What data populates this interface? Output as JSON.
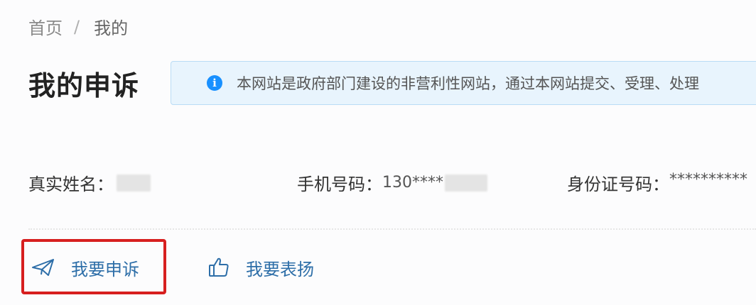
{
  "breadcrumb": {
    "home": "首页",
    "separator": "/",
    "current": "我的"
  },
  "page_title": "我的申诉",
  "notice": {
    "icon": "info-icon",
    "icon_glyph": "i",
    "text": "本网站是政府部门建设的非营利性网站，通过本网站提交、受理、处理"
  },
  "user_info": {
    "name_label": "真实姓名：",
    "name_value": "",
    "phone_label": "手机号码：",
    "phone_value": "130****",
    "id_label": "身份证号码：",
    "id_value": "**********"
  },
  "actions": {
    "complain": {
      "label": "我要申诉",
      "icon": "paper-plane-icon"
    },
    "praise": {
      "label": "我要表扬",
      "icon": "thumbs-up-icon"
    }
  },
  "colors": {
    "accent": "#2d6ea8",
    "info": "#1890ff",
    "notice_bg": "#e8f4fd",
    "highlight": "#d71f1f"
  }
}
